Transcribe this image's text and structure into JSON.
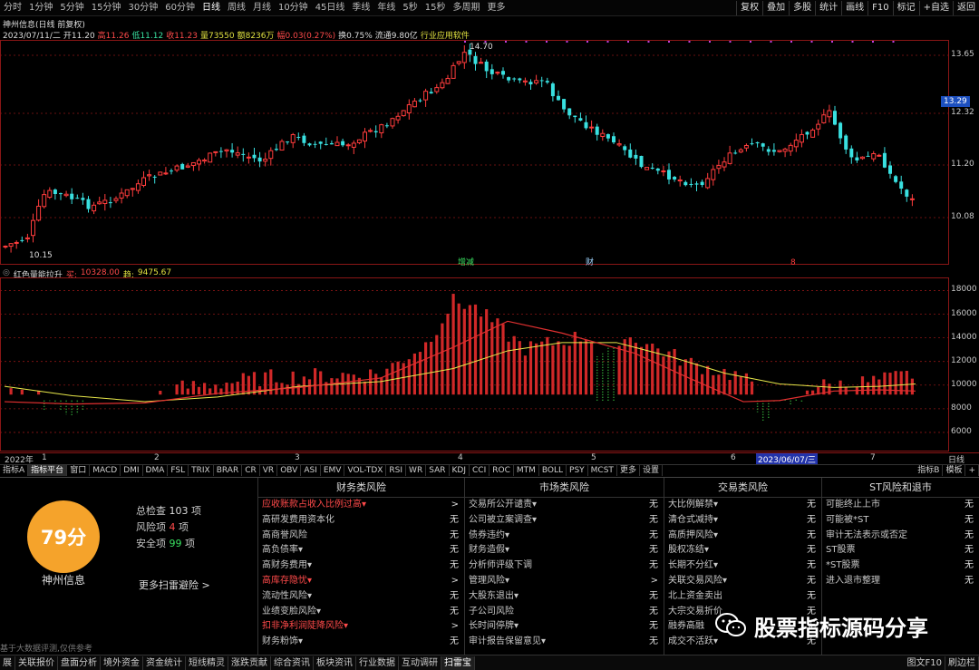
{
  "toolbar": {
    "periods": [
      "分时",
      "1分钟",
      "5分钟",
      "15分钟",
      "30分钟",
      "60分钟",
      "日线",
      "周线",
      "月线",
      "10分钟",
      "45日线",
      "季线",
      "年线",
      "5秒",
      "15秒",
      "多周期",
      "更多"
    ],
    "active_period": "日线",
    "right_buttons": [
      "复权",
      "叠加",
      "多股",
      "统计",
      "画线",
      "F10",
      "标记",
      "+自选",
      "返回"
    ]
  },
  "stock_header": {
    "title": "神州信息(日线 前复权)",
    "date": "2023/07/11/二",
    "open": "开11.20",
    "high": "高11.26",
    "low": "低11.12",
    "close": "收11.23",
    "volume": "量73550",
    "amount": "额8236万",
    "change": "幅0.03(0.27%)",
    "turnover": "换0.75%",
    "float_mv": "流通9.80亿",
    "industry": "行业应用软件"
  },
  "price_axis": {
    "labels": [
      "13.65",
      "13.29",
      "12.32",
      "11.20",
      "10.08"
    ],
    "current": "13.29"
  },
  "price_marks": {
    "high_label": "14.70",
    "low_label": "10.15"
  },
  "event_marks": {
    "m1": "增减",
    "m2": "财",
    "m3": "8"
  },
  "indicator": {
    "name": "红色量能拉升",
    "v1_label": "买:",
    "v1": "10328.00",
    "v2_label": "趋:",
    "v2": "9475.67"
  },
  "vol_axis": {
    "labels": [
      "18000",
      "16000",
      "14000",
      "12000",
      "10000",
      "8000",
      "6000"
    ]
  },
  "date_axis": {
    "labels": [
      "2022年",
      "1",
      "2",
      "3",
      "4",
      "5",
      "6",
      "7"
    ],
    "highlight": "2023/06/07/三",
    "right": "日线"
  },
  "indicator_tabs": [
    "指标A",
    "指标平台",
    "窗口",
    "MACD",
    "DMI",
    "DMA",
    "FSL",
    "TRIX",
    "BRAR",
    "CR",
    "VR",
    "OBV",
    "ASI",
    "EMV",
    "VOL-TDX",
    "RSI",
    "WR",
    "SAR",
    "KDJ",
    "CCI",
    "ROC",
    "MTM",
    "BOLL",
    "PSY",
    "MCST",
    "更多",
    "设置"
  ],
  "indicator_tabs_right": [
    "指标B",
    "模板",
    "+"
  ],
  "risk_summary": {
    "score": "79分",
    "stock_name": "神州信息",
    "total_label": "总检查",
    "total_value": "103",
    "total_unit": "项",
    "risk_label": "风险项",
    "risk_value": "4",
    "risk_unit": "项",
    "safe_label": "安全项",
    "safe_value": "99",
    "safe_unit": "项",
    "more_link": "更多扫雷避险 >",
    "disclaimer": "基于大数据评测,仅供参考"
  },
  "risk_columns": [
    {
      "title": "财务类风险",
      "items": [
        {
          "label": "应收账款占收入比例过高▾",
          "value": ">",
          "risk": true
        },
        {
          "label": "高研发费用资本化",
          "value": "无",
          "risk": false
        },
        {
          "label": "高商誉风险",
          "value": "无",
          "risk": false
        },
        {
          "label": "高负债率▾",
          "value": "无",
          "risk": false
        },
        {
          "label": "高财务费用▾",
          "value": "无",
          "risk": false
        },
        {
          "label": "高库存隐忧▾",
          "value": ">",
          "risk": true
        },
        {
          "label": "流动性风险▾",
          "value": "无",
          "risk": false
        },
        {
          "label": "业绩变脸风险▾",
          "value": "无",
          "risk": false
        },
        {
          "label": "扣非净利润陡降风险▾",
          "value": ">",
          "risk": true
        },
        {
          "label": "财务粉饰▾",
          "value": "无",
          "risk": false
        }
      ]
    },
    {
      "title": "市场类风险",
      "items": [
        {
          "label": "交易所公开谴责▾",
          "value": "无",
          "risk": false
        },
        {
          "label": "公司被立案调查▾",
          "value": "无",
          "risk": false
        },
        {
          "label": "债券违约▾",
          "value": "无",
          "risk": false
        },
        {
          "label": "财务造假▾",
          "value": "无",
          "risk": false
        },
        {
          "label": "分析师评级下调",
          "value": "无",
          "risk": false
        },
        {
          "label": "管理风险▾",
          "value": ">",
          "risk": false
        },
        {
          "label": "大股东退出▾",
          "value": "无",
          "risk": false
        },
        {
          "label": "子公司风险",
          "value": "无",
          "risk": false
        },
        {
          "label": "长时间停牌▾",
          "value": "无",
          "risk": false
        },
        {
          "label": "审计报告保留意见▾",
          "value": "无",
          "risk": false
        }
      ]
    },
    {
      "title": "交易类风险",
      "items": [
        {
          "label": "大比例解禁▾",
          "value": "无",
          "risk": false
        },
        {
          "label": "清仓式减持▾",
          "value": "无",
          "risk": false
        },
        {
          "label": "高质押风险▾",
          "value": "无",
          "risk": false
        },
        {
          "label": "股权冻结▾",
          "value": "无",
          "risk": false
        },
        {
          "label": "长期不分红▾",
          "value": "无",
          "risk": false
        },
        {
          "label": "关联交易风险▾",
          "value": "无",
          "risk": false
        },
        {
          "label": "北上资金卖出",
          "value": "无",
          "risk": false
        },
        {
          "label": "大宗交易折价",
          "value": "无",
          "risk": false
        },
        {
          "label": "融券高融",
          "value": "无",
          "risk": false
        },
        {
          "label": "成交不活跃▾",
          "value": "无",
          "risk": false
        }
      ]
    },
    {
      "title": "ST风险和退市",
      "items": [
        {
          "label": "可能终止上市",
          "value": "无",
          "risk": false
        },
        {
          "label": "可能被*ST",
          "value": "无",
          "risk": false
        },
        {
          "label": "审计无法表示或否定",
          "value": "无",
          "risk": false
        },
        {
          "label": "ST股票",
          "value": "无",
          "risk": false
        },
        {
          "label": "*ST股票",
          "value": "无",
          "risk": false
        },
        {
          "label": "进入退市整理",
          "value": "无",
          "risk": false
        }
      ]
    }
  ],
  "watermark": "股票指标源码分享",
  "bottom_tabs": [
    "展",
    "关联报价",
    "盘面分析",
    "境外资金",
    "资金统计",
    "短线精灵",
    "涨跌贡献",
    "综合资讯",
    "板块资讯",
    "行业数据",
    "互动调研",
    "扫雷宝"
  ],
  "bottom_active": "扫雷宝",
  "bottom_right": [
    "图文F10",
    "刷边栏"
  ],
  "colors": {
    "up": "#ff3c3c",
    "down": "#39e0e0",
    "grid": "#8a1616",
    "ma_yellow": "#e8e84a",
    "ma_red": "#e03030",
    "score": "#f5a32b"
  }
}
